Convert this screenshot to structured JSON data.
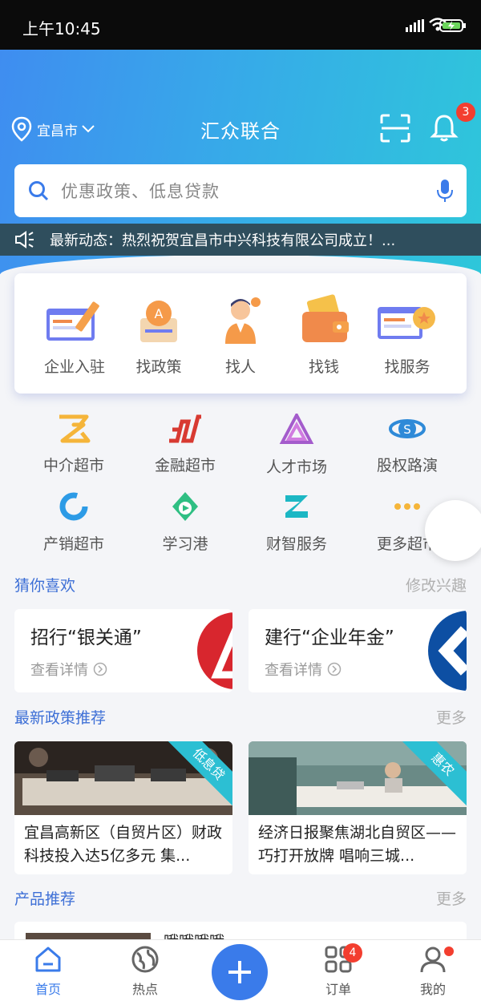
{
  "status_bar": {
    "time": "上午10:45"
  },
  "header": {
    "location": "宜昌市",
    "title": "汇众联合",
    "notification_count": "3"
  },
  "search": {
    "placeholder": "优惠政策、低息贷款"
  },
  "news": {
    "text": "最新动态：热烈祝贺宜昌市中兴科技有限公司成立！..."
  },
  "services": [
    {
      "label": "企业入驻",
      "icon": "enterprise-icon"
    },
    {
      "label": "找政策",
      "icon": "policy-icon"
    },
    {
      "label": "找人",
      "icon": "person-icon"
    },
    {
      "label": "找钱",
      "icon": "wallet-icon"
    },
    {
      "label": "找服务",
      "icon": "service-icon"
    }
  ],
  "markets": [
    {
      "label": "中介超市",
      "icon": "agency-icon"
    },
    {
      "label": "金融超市",
      "icon": "finance-icon"
    },
    {
      "label": "人才市场",
      "icon": "talent-icon"
    },
    {
      "label": "股权路演",
      "icon": "equity-icon"
    },
    {
      "label": "产销超市",
      "icon": "sales-icon"
    },
    {
      "label": "学习港",
      "icon": "learning-icon"
    },
    {
      "label": "财智服务",
      "icon": "wealth-icon"
    },
    {
      "label": "更多超市",
      "icon": "more-icon"
    }
  ],
  "guess": {
    "title": "猜你喜欢",
    "action": "修改兴趣",
    "items": [
      {
        "title": "招行“银关通”",
        "detail": "查看详情"
      },
      {
        "title": "建行“企业年金”",
        "detail": "查看详情"
      }
    ]
  },
  "policy": {
    "title": "最新政策推荐",
    "more": "更多",
    "items": [
      {
        "tag": "低息贷",
        "text": "宜昌高新区（自贸片区）财政科技投入达5亿多元 集..."
      },
      {
        "tag": "惠农",
        "text": "经济日报聚焦湖北自贸区——巧打开放牌 唱响三城..."
      }
    ]
  },
  "products": {
    "title": "产品推荐",
    "more": "更多",
    "peek_text": "哦哦哦哦"
  },
  "tabbar": {
    "items": [
      {
        "label": "首页"
      },
      {
        "label": "热点"
      },
      {
        "label": "订单",
        "badge": "4"
      },
      {
        "label": "我的"
      }
    ]
  },
  "colors": {
    "primary": "#3a7bea",
    "accent_title": "#3d6fd6",
    "badge": "#f33e2f",
    "tag": "#2cbfd3"
  }
}
